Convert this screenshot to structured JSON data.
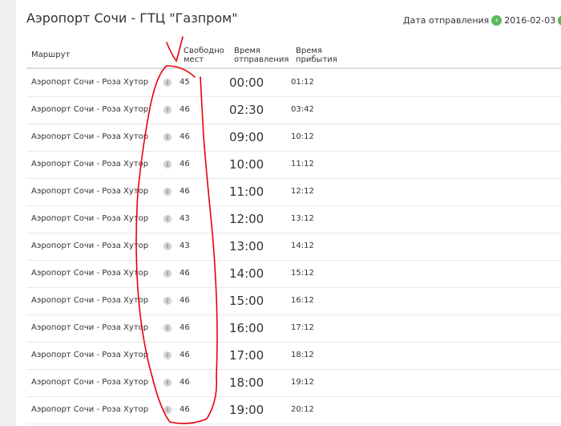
{
  "header": {
    "title": "Аэропорт Сочи - ГТЦ \"Газпром\"",
    "date_label": "Дата отправления",
    "date_value": "2016-02-03",
    "prev_icon": "chevron-left-icon",
    "next_icon": "chevron-right-icon",
    "prev_glyph": "‹",
    "next_glyph": "›"
  },
  "table": {
    "columns": {
      "route": "Маршрут",
      "seats": "Свободно мест",
      "departure": "Время отправления",
      "arrival": "Время прибытия"
    },
    "info_glyph": "i",
    "rows": [
      {
        "route": "Аэропорт Сочи - Роза Хутор",
        "seats": "45",
        "departure": "00:00",
        "arrival": "01:12"
      },
      {
        "route": "Аэропорт Сочи - Роза Хутор",
        "seats": "46",
        "departure": "02:30",
        "arrival": "03:42"
      },
      {
        "route": "Аэропорт Сочи - Роза Хутор",
        "seats": "46",
        "departure": "09:00",
        "arrival": "10:12"
      },
      {
        "route": "Аэропорт Сочи - Роза Хутор",
        "seats": "46",
        "departure": "10:00",
        "arrival": "11:12"
      },
      {
        "route": "Аэропорт Сочи - Роза Хутор",
        "seats": "46",
        "departure": "11:00",
        "arrival": "12:12"
      },
      {
        "route": "Аэропорт Сочи - Роза Хутор",
        "seats": "43",
        "departure": "12:00",
        "arrival": "13:12"
      },
      {
        "route": "Аэропорт Сочи - Роза Хутор",
        "seats": "43",
        "departure": "13:00",
        "arrival": "14:12"
      },
      {
        "route": "Аэропорт Сочи - Роза Хутор",
        "seats": "46",
        "departure": "14:00",
        "arrival": "15:12"
      },
      {
        "route": "Аэропорт Сочи - Роза Хутор",
        "seats": "46",
        "departure": "15:00",
        "arrival": "16:12"
      },
      {
        "route": "Аэропорт Сочи - Роза Хутор",
        "seats": "46",
        "departure": "16:00",
        "arrival": "17:12"
      },
      {
        "route": "Аэропорт Сочи - Роза Хутор",
        "seats": "46",
        "departure": "17:00",
        "arrival": "18:12"
      },
      {
        "route": "Аэропорт Сочи - Роза Хутор",
        "seats": "46",
        "departure": "18:00",
        "arrival": "19:12"
      },
      {
        "route": "Аэропорт Сочи - Роза Хутор",
        "seats": "46",
        "departure": "19:00",
        "arrival": "20:12"
      }
    ]
  },
  "colors": {
    "accent": "#5cb85c",
    "annotation": "#e8000b"
  }
}
